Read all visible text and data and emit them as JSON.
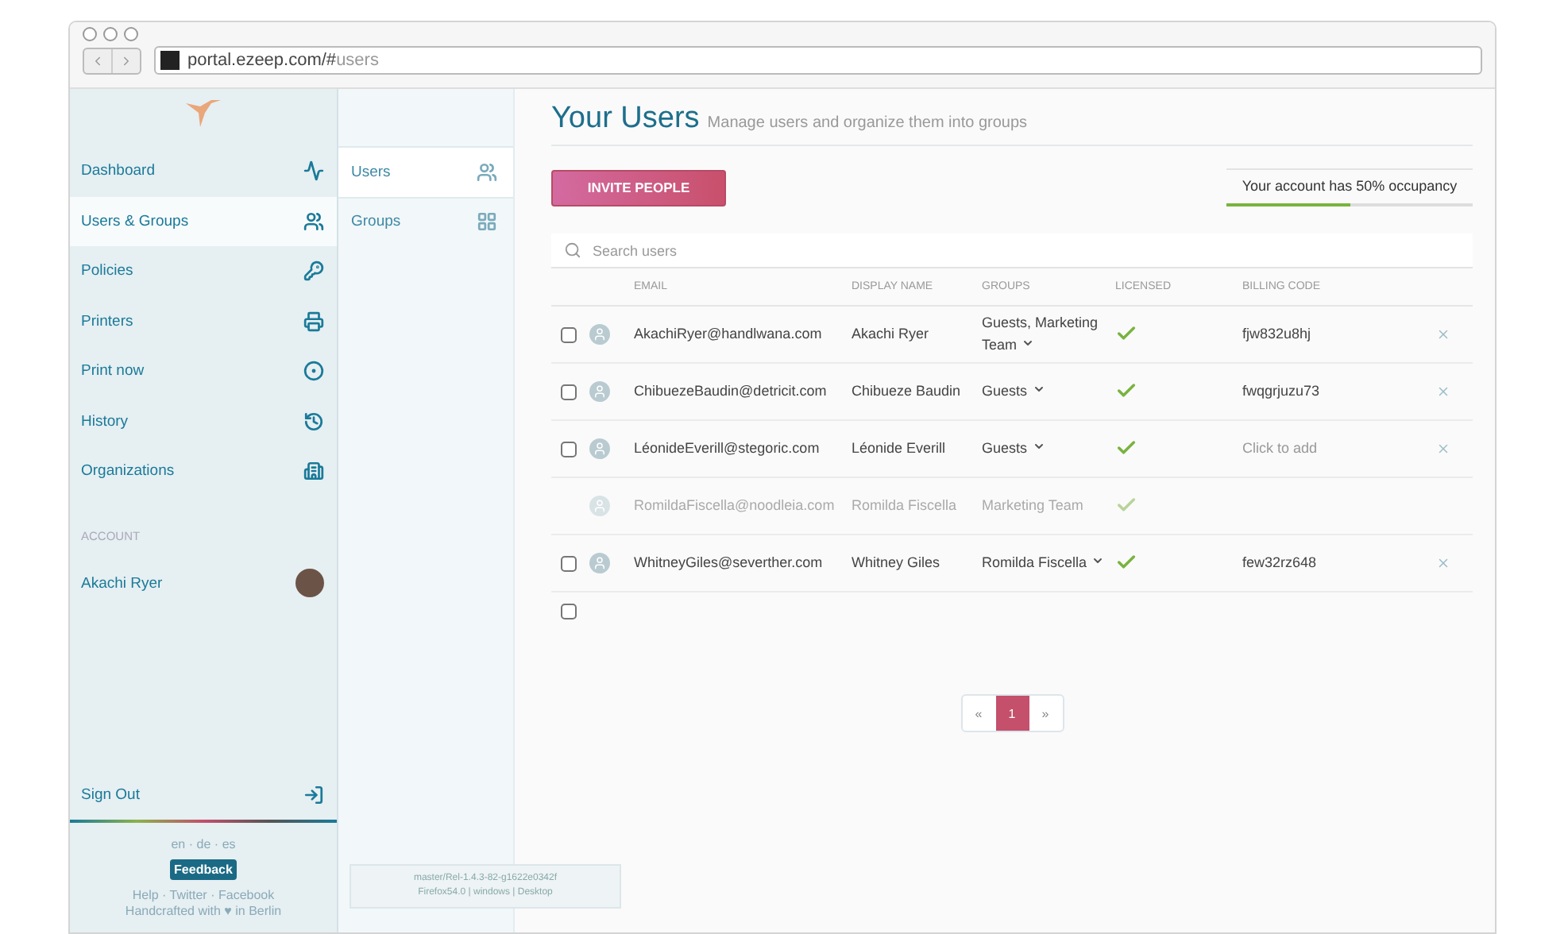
{
  "browser": {
    "url_host": "portal.ezeep.com/#",
    "url_path": "users"
  },
  "sidebar": {
    "items": [
      {
        "label": "Dashboard",
        "selected": false
      },
      {
        "label": "Users & Groups",
        "selected": true
      },
      {
        "label": "Policies",
        "selected": false
      },
      {
        "label": "Printers",
        "selected": false
      },
      {
        "label": "Print now",
        "selected": false
      },
      {
        "label": "History",
        "selected": false
      },
      {
        "label": "Organizations",
        "selected": false
      }
    ],
    "separator": "·",
    "account_heading": "ACCOUNT",
    "account_name": "Akachi Ryer",
    "sign_out": "Sign Out",
    "languages": [
      "en",
      "de",
      "es"
    ],
    "feedback": "Feedback",
    "footer_links": [
      "Help",
      "Twitter",
      "Facebook"
    ],
    "footer_credit": "Handcrafted with ♥ in Berlin"
  },
  "subnav": {
    "items": [
      {
        "label": "Users",
        "selected": true
      },
      {
        "label": "Groups",
        "selected": false
      }
    ]
  },
  "version": {
    "line1": "master/Rel-1.4.3-82-g1622e0342f",
    "line2": "Firefox54.0 | windows | Desktop"
  },
  "header": {
    "title": "Your Users",
    "subtitle": "Manage users and organize them into groups"
  },
  "invite_button": "INVITE PEOPLE",
  "occupancy": {
    "text": "Your account has 50% occupancy",
    "level": 0.5
  },
  "search": {
    "placeholder": "Search users"
  },
  "table": {
    "columns": [
      "EMAIL",
      "DISPLAY NAME",
      "GROUPS",
      "LICENSED",
      "BILLING CODE"
    ],
    "rows": [
      {
        "email": "AkachiRyer@handlwana.com",
        "name": "Akachi Ryer",
        "groups": "Guests, Marketing Team",
        "has_menu": true,
        "licensed": true,
        "billing": "fjw832u8hj",
        "disabled": false,
        "checked": false
      },
      {
        "email": "ChibuezeBaudin@detricit.com",
        "name": "Chibueze Baudin",
        "groups": "Guests",
        "has_menu": true,
        "licensed": true,
        "billing": "fwqgrjuzu73",
        "disabled": false,
        "checked": false
      },
      {
        "email": "LéonideEverill@stegoric.com",
        "name": "Léonide Everill",
        "groups": "Guests",
        "has_menu": true,
        "licensed": true,
        "billing_placeholder": "Click to add",
        "disabled": false,
        "checked": false
      },
      {
        "email": "RomildaFiscella@noodleia.com",
        "name": "Romilda Fiscella",
        "groups": "Marketing Team",
        "has_menu": false,
        "licensed": true,
        "disabled": true
      },
      {
        "email": "WhitneyGiles@severther.com",
        "name": "Whitney Giles",
        "groups": "Romilda Fiscella",
        "has_menu": true,
        "licensed": true,
        "billing": "few32rz648",
        "disabled": false,
        "checked": false
      }
    ],
    "select_all_checked": false
  },
  "pagination": {
    "prev": "«",
    "pages": [
      {
        "label": "1",
        "selected": true
      }
    ],
    "next": "»"
  }
}
